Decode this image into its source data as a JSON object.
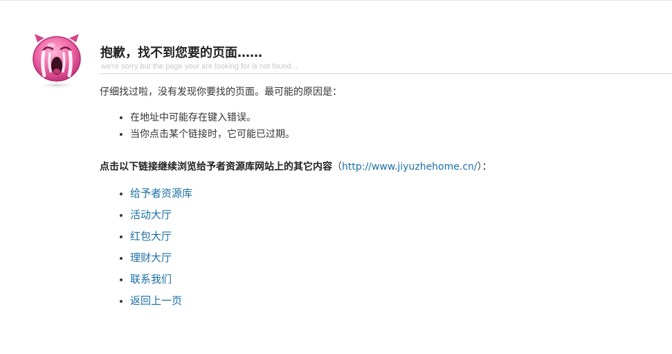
{
  "header": {
    "title": "抱歉，找不到您要的页面……",
    "subtitle": "we're sorry but the page your are looking for is not found..."
  },
  "intro": "仔细找过啦，没有发现你要找的页面。最可能的原因是：",
  "reasons": [
    "在地址中可能存在键入错误。",
    "当你点击某个链接时，它可能已过期。"
  ],
  "continue": {
    "label": "点击以下链接继续浏览给予者资源库网站上的其它内容",
    "open_paren": "（",
    "link_text": "http://www.jiyuzhehome.cn/",
    "close_paren": "）："
  },
  "links": [
    "给予者资源库",
    "活动大厅",
    "红包大厅",
    "理财大厅",
    "联系我们",
    "返回上一页"
  ],
  "colors": {
    "link": "#1a6fa8",
    "mascot": "#e8529a"
  },
  "icons": {
    "mascot": "crying-pig-icon"
  }
}
